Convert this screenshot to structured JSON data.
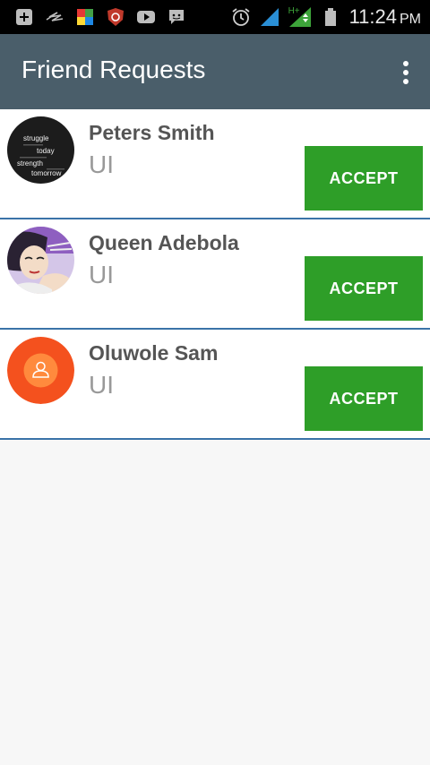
{
  "status_bar": {
    "icons_left": [
      "add-box-icon",
      "signature-icon",
      "colorful-app-icon",
      "shield-app-icon",
      "youtube-icon",
      "chat-bubble-icon"
    ],
    "icons_right": [
      "alarm-icon",
      "signal-icon",
      "data-hplus-icon",
      "battery-icon"
    ],
    "network_label": "H+",
    "time": "11:24",
    "ampm": "PM"
  },
  "app_bar": {
    "title": "Friend Requests",
    "menu_icon": "overflow-menu-icon"
  },
  "requests": [
    {
      "name": "Peters Smith",
      "subtitle": "UI",
      "button_label": "ACCEPT",
      "avatar": "quote-image-avatar",
      "avatar_text": [
        "struggle",
        "today",
        "strength",
        "tomorrow"
      ]
    },
    {
      "name": "Queen Adebola",
      "subtitle": "UI",
      "button_label": "ACCEPT",
      "avatar": "cartoon-portrait-avatar"
    },
    {
      "name": "Oluwole Sam",
      "subtitle": "UI",
      "button_label": "ACCEPT",
      "avatar": "default-user-avatar"
    }
  ],
  "colors": {
    "status_bar": "#000000",
    "app_bar": "#4a5e6a",
    "accept_button": "#2e9e28",
    "row_divider": "#3a73a8",
    "background": "#f7f7f7",
    "default_avatar": "#f4511e"
  }
}
